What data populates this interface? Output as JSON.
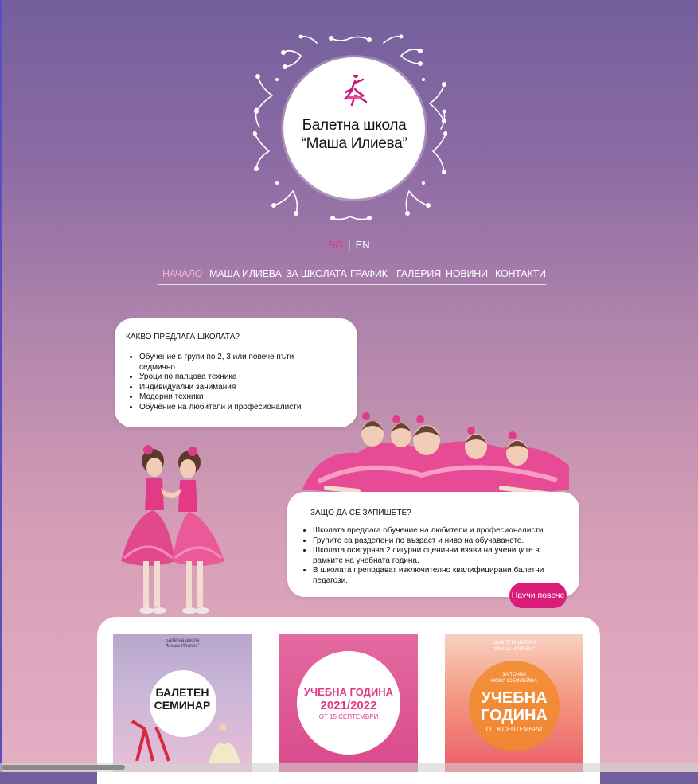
{
  "logo": {
    "line1": "Балетна школа",
    "line2": "“Маша Илиева”"
  },
  "language": {
    "bg": "BG",
    "separator": "|",
    "en": "EN"
  },
  "nav": [
    {
      "label": "НАЧАЛО",
      "active": true
    },
    {
      "label": "МАША ИЛИЕВА",
      "active": false
    },
    {
      "label": "ЗА ШКОЛАТА",
      "active": false
    },
    {
      "label": "ГРАФИК",
      "active": false
    },
    {
      "label": "ГАЛЕРИЯ",
      "active": false
    },
    {
      "label": "НОВИНИ",
      "active": false
    },
    {
      "label": "КОНТАКТИ",
      "active": false
    }
  ],
  "offer": {
    "title": "КАКВО ПРЕДЛАГА ШКОЛАТА?",
    "items": [
      "Обучение в групи по 2, 3 или повече пъти седмично",
      "Уроци по палцова техника",
      "Индивидуални занимания",
      "Модерни техники",
      "Обучение на любители и професионалисти"
    ]
  },
  "why": {
    "title": "ЗАЩО ДА СЕ ЗАПИШЕТЕ?",
    "items": [
      "Школата предлага обучение на любители и професионалисти.",
      "Групите са разделени по възраст и ниво на обучаването.",
      "Школата осигурява 2 сигурни сценични изяви на учениците в рамките на учебната година.",
      "В школата преподават изключително квалифицирани балетни педагози."
    ],
    "button": "Научи повече"
  },
  "posters": [
    {
      "top": "Балетна школа",
      "top2": "“Маша Илиева”",
      "main1": "БАЛЕТЕН",
      "main2": "СЕМИНАР"
    },
    {
      "main1": "УЧЕБНА ГОДИНА",
      "main2": "2021/2022",
      "sub": "ОТ 15 СЕПТЕМВРИ"
    },
    {
      "top": "БАЛЕТНА ШКОЛА",
      "top2": "“МАША ИЛИЕВА”",
      "pre": "ЗАПОЧВА",
      "pre2": "НОВА ЮБИЛЕЙНА",
      "main1": "УЧЕБНА",
      "main2": "ГОДИНА",
      "sub": "ОТ 8 СЕПТЕМВРИ"
    }
  ],
  "colors": {
    "accent": "#d81c78",
    "activeLang": "#e6318a",
    "activeNav": "#f4b4cf"
  }
}
